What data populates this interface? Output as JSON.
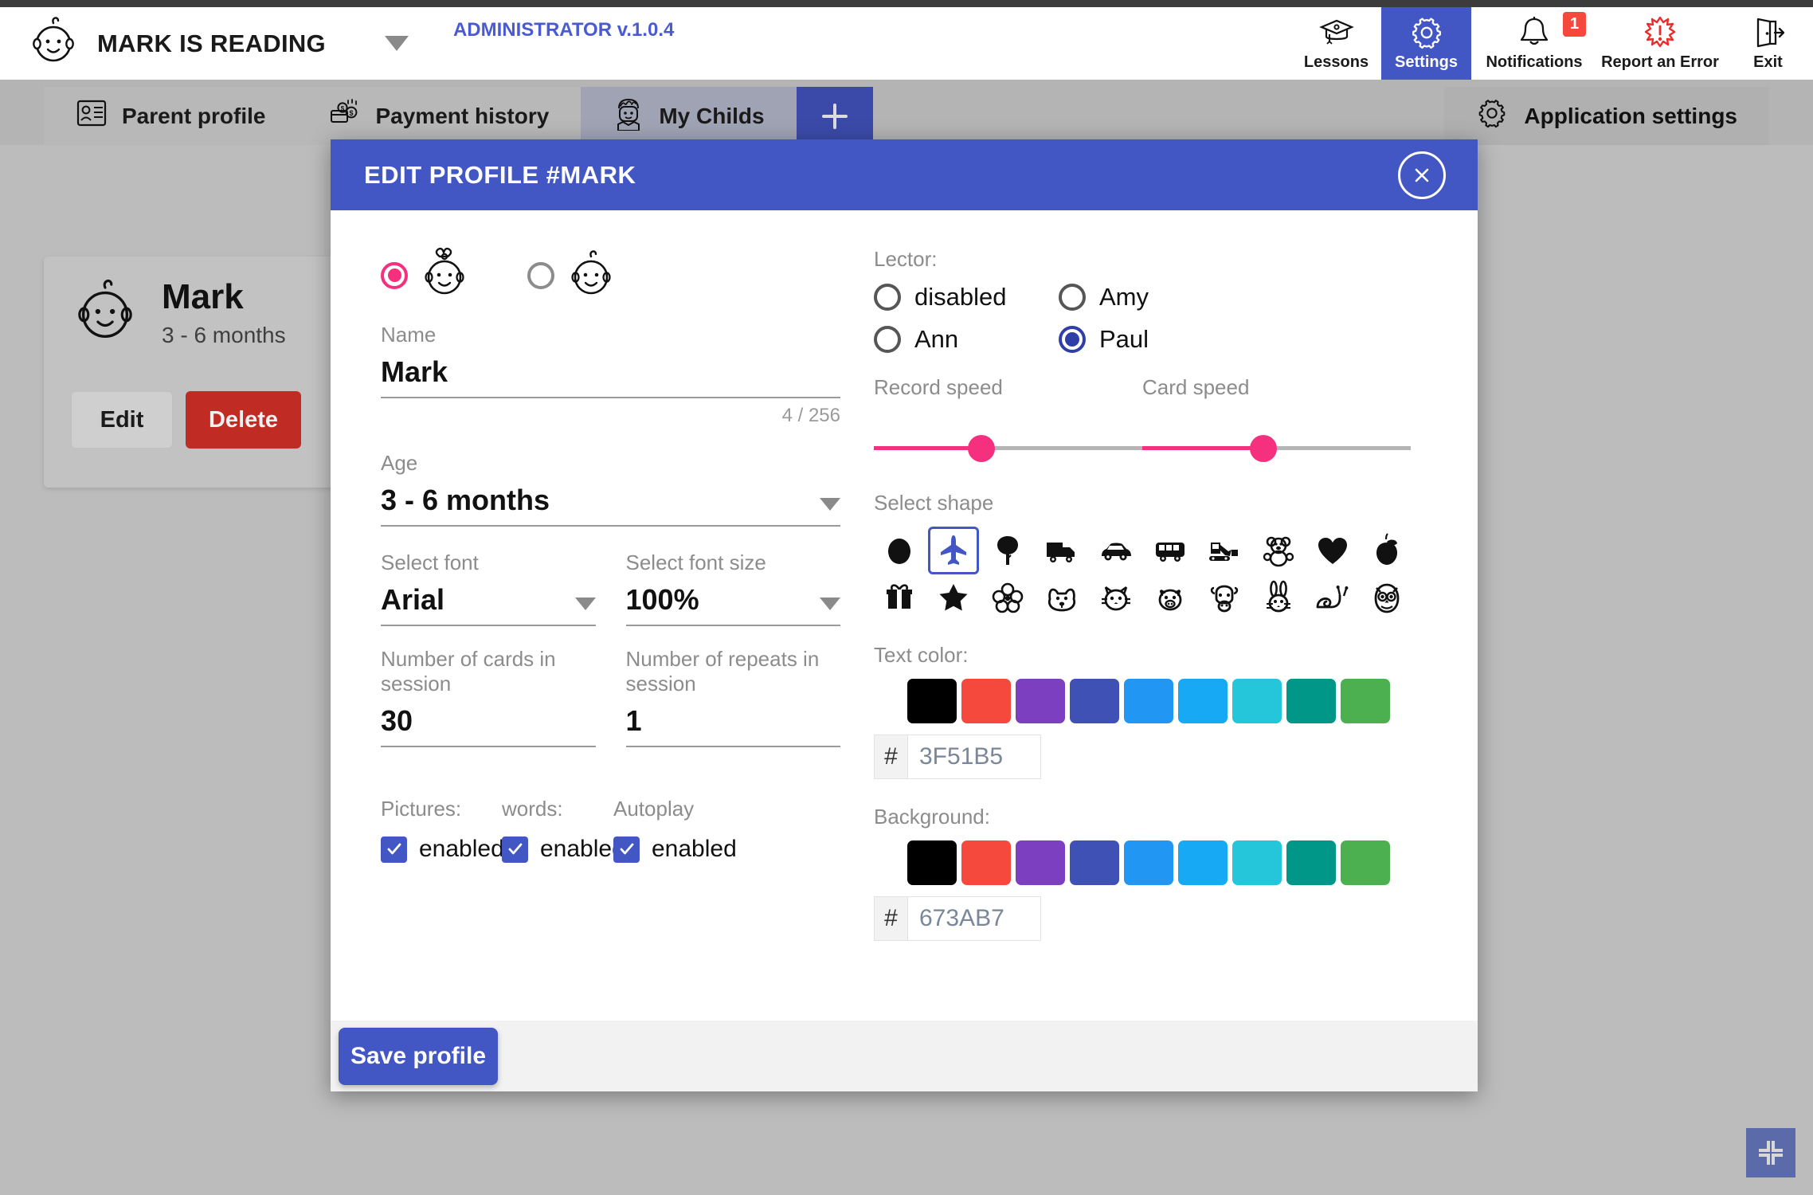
{
  "header": {
    "brand_title": "MARK IS READING",
    "version": "ADMINISTRATOR v.1.0.4",
    "nav": [
      {
        "label": "Lessons",
        "icon": "graduation-cap-icon",
        "active": false,
        "badge": null
      },
      {
        "label": "Settings",
        "icon": "gear-icon",
        "active": true,
        "badge": null
      },
      {
        "label": "Notifications",
        "icon": "bell-icon",
        "active": false,
        "badge": "1"
      },
      {
        "label": "Report an Error",
        "icon": "error-burst-icon",
        "active": false,
        "badge": null
      },
      {
        "label": "Exit",
        "icon": "exit-door-icon",
        "active": false,
        "badge": null
      }
    ]
  },
  "tabbar": {
    "tabs": [
      {
        "label": "Parent profile",
        "icon": "id-card-icon",
        "selected": false
      },
      {
        "label": "Payment history",
        "icon": "money-cards-icon",
        "selected": false
      },
      {
        "label": "My Childs",
        "icon": "child-face-icon",
        "selected": true
      }
    ],
    "add_tab_label": "+",
    "app_settings_label": "Application settings"
  },
  "child_card": {
    "name": "Mark",
    "age": "3 - 6 months",
    "edit_label": "Edit",
    "delete_label": "Delete"
  },
  "modal": {
    "title": "EDIT PROFILE #MARK",
    "close_label": "✕",
    "gender": {
      "girl_selected": true,
      "boy_selected": false
    },
    "name": {
      "label": "Name",
      "value": "Mark",
      "counter": "4 / 256"
    },
    "age": {
      "label": "Age",
      "value": "3 - 6 months"
    },
    "font": {
      "label": "Select font",
      "value": "Arial"
    },
    "font_size": {
      "label": "Select font size",
      "value": "100%"
    },
    "cards_in_session": {
      "label": "Number of cards in session",
      "value": "30"
    },
    "repeats_in_session": {
      "label": "Number of repeats in session",
      "value": "1"
    },
    "checkboxes": [
      {
        "label": "Pictures:",
        "value": "enabled",
        "checked": true
      },
      {
        "label": "words:",
        "value": "enabled",
        "checked": true
      },
      {
        "label": "Autoplay",
        "value": "enabled",
        "checked": true
      }
    ],
    "lector": {
      "label": "Lector:",
      "options": [
        {
          "label": "disabled",
          "selected": false
        },
        {
          "label": "Ann",
          "selected": false
        },
        {
          "label": "Amy",
          "selected": false
        },
        {
          "label": "Paul",
          "selected": true
        }
      ]
    },
    "record_speed": {
      "label": "Record speed",
      "percent": 40
    },
    "card_speed": {
      "label": "Card speed",
      "percent": 45
    },
    "shapes": {
      "label": "Select shape",
      "selected_index": 1,
      "items": [
        "circle-icon",
        "airplane-icon",
        "tree-icon",
        "truck-icon",
        "car-icon",
        "bus-icon",
        "excavator-icon",
        "teddy-bear-icon",
        "heart-icon",
        "apple-icon",
        "gift-icon",
        "star-icon",
        "flower-icon",
        "dog-icon",
        "cat-icon",
        "pig-icon",
        "cow-icon",
        "rabbit-icon",
        "snail-icon",
        "owl-icon"
      ]
    },
    "text_color": {
      "label": "Text color:",
      "hex_prefix": "#",
      "hex_value": "3F51B5",
      "swatches": [
        "#000000",
        "#F4493C",
        "#7B3FBF",
        "#3F51B5",
        "#2196F3",
        "#18A9F5",
        "#26C6DA",
        "#009688",
        "#4CAF50"
      ]
    },
    "background_color": {
      "label": "Background:",
      "hex_prefix": "#",
      "hex_value": "673AB7",
      "swatches": [
        "#000000",
        "#F4493C",
        "#7B3FBF",
        "#3F51B5",
        "#2196F3",
        "#18A9F5",
        "#26C6DA",
        "#009688",
        "#4CAF50"
      ]
    },
    "save_label": "Save profile"
  },
  "fullscreen_button": {
    "icon": "collapse-fullscreen-icon"
  },
  "colors": {
    "accent_blue": "#4357c4",
    "accent_pink": "#f5317f",
    "danger_red": "#c02b24"
  }
}
